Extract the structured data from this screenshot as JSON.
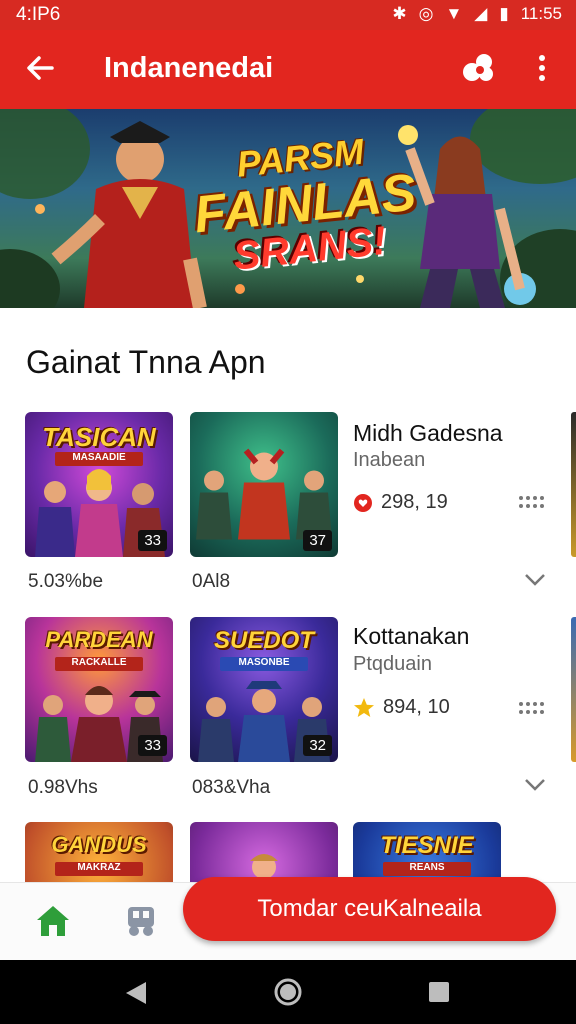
{
  "status_bar": {
    "time": "4:IP6",
    "clock": "11:55"
  },
  "app_bar": {
    "title": "Indanenedai"
  },
  "banner": {
    "line1": "PARSM",
    "line2": "FAINLAS",
    "line3": "SRANS!"
  },
  "section": {
    "title": "Gainat Tnna Apn"
  },
  "rows": [
    {
      "cards": [
        {
          "title": "TASICAN",
          "subtitle": "MASAADIE",
          "badge": "33"
        },
        {
          "title": "",
          "subtitle": "",
          "badge": "37"
        }
      ],
      "captions": [
        "5.03%be",
        "0Al8"
      ],
      "app_name": "Midh Gadesna",
      "app_subtitle": "Inabean",
      "rating": "298, 19",
      "rating_icon": "heart-badge-icon"
    },
    {
      "cards": [
        {
          "title": "PARDEAN",
          "subtitle": "RACKALLE",
          "badge": "33"
        },
        {
          "title": "SUEDOT",
          "subtitle": "MASONBE",
          "badge": "32"
        }
      ],
      "captions": [
        "0.98Vhs",
        "083&Vha"
      ],
      "app_name": "Kottanakan",
      "app_subtitle": "Ptqduain",
      "rating": "894, 10",
      "rating_icon": "star-icon"
    },
    {
      "cards": [
        {
          "title": "GANDUS",
          "subtitle": "MAKRAZ"
        },
        {
          "title": "",
          "subtitle": ""
        },
        {
          "title": "TIESNIE",
          "subtitle": "REANS"
        }
      ]
    }
  ],
  "cta": {
    "label": "Tomdar ceuKalneaila"
  },
  "colors": {
    "accent": "#e2261f",
    "home_active": "#2e9e3a",
    "star": "#f2b90f"
  }
}
